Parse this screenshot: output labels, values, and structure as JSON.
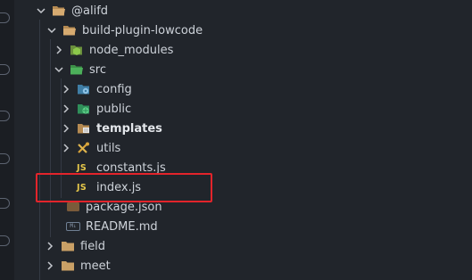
{
  "colors": {
    "background": "#21252b",
    "highlight_border": "#e3242b",
    "folder": "#c9a066",
    "js_badge": "#e6c84a"
  },
  "tree": {
    "items": [
      {
        "label": "@alifd",
        "icon": "folder-open-icon",
        "expanded": true
      },
      {
        "label": "build-plugin-lowcode",
        "icon": "folder-open-icon",
        "expanded": true
      },
      {
        "label": "node_modules",
        "icon": "node-modules-folder-icon",
        "expanded": false
      },
      {
        "label": "src",
        "icon": "src-folder-icon",
        "expanded": true
      },
      {
        "label": "config",
        "icon": "config-folder-icon",
        "expanded": false
      },
      {
        "label": "public",
        "icon": "public-folder-icon",
        "expanded": false
      },
      {
        "label": "templates",
        "icon": "templates-folder-icon",
        "expanded": false
      },
      {
        "label": "utils",
        "icon": "utils-folder-icon",
        "expanded": false
      },
      {
        "label": "constants.js",
        "icon": "js-file-icon",
        "badge": "JS"
      },
      {
        "label": "index.js",
        "icon": "js-file-icon",
        "badge": "JS",
        "highlighted": true
      },
      {
        "label": "package.json",
        "icon": "json-file-icon"
      },
      {
        "label": "README.md",
        "icon": "markdown-file-icon",
        "badge": "M↓"
      },
      {
        "label": "field",
        "icon": "folder-icon",
        "expanded": false
      },
      {
        "label": "meet",
        "icon": "folder-icon",
        "expanded": false
      }
    ]
  }
}
